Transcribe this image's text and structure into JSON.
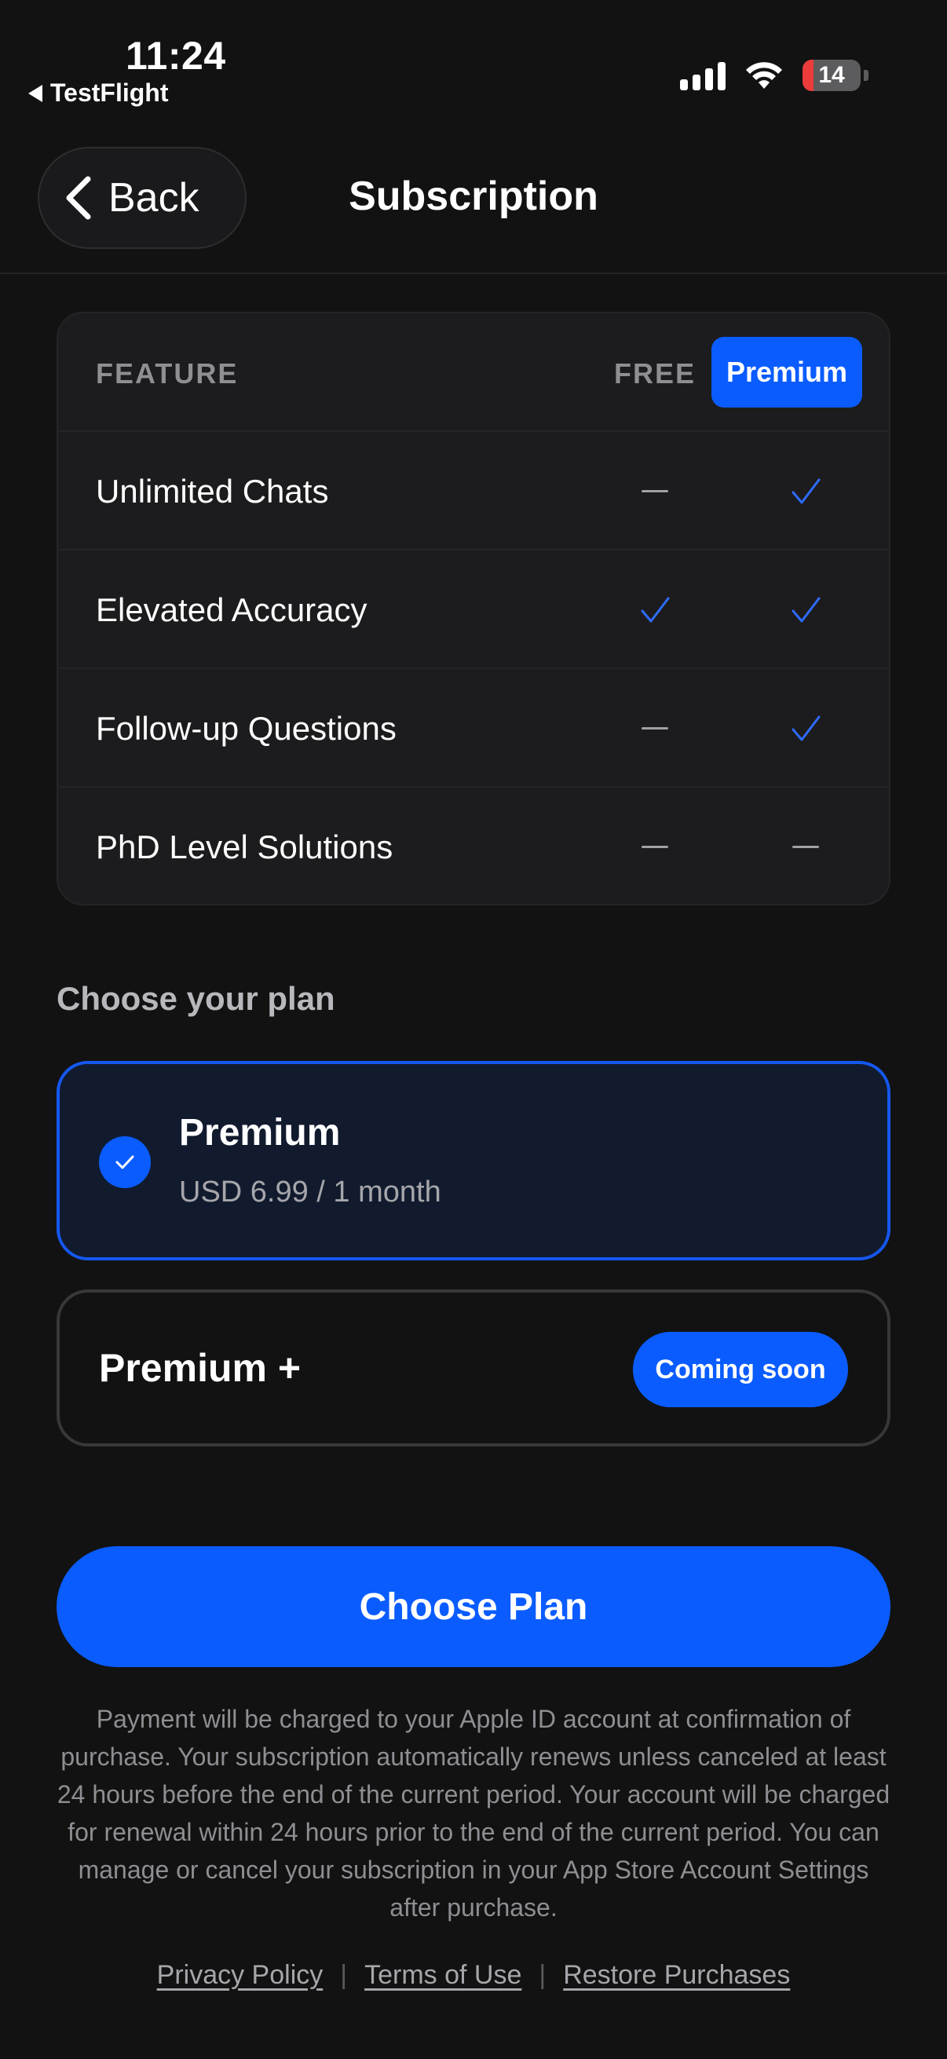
{
  "status_bar": {
    "time": "11:24",
    "back_app": "TestFlight",
    "battery": "14",
    "icons": [
      "signal-icon",
      "wifi-icon",
      "battery-icon"
    ]
  },
  "nav": {
    "back_label": "Back",
    "title": "Subscription"
  },
  "feature_table": {
    "headers": {
      "feature": "FEATURE",
      "free": "FREE",
      "premium": "Premium"
    },
    "rows": [
      {
        "name": "Unlimited Chats",
        "free": "dash",
        "premium": "check"
      },
      {
        "name": "Elevated Accuracy",
        "free": "check",
        "premium": "check"
      },
      {
        "name": "Follow-up Questions",
        "free": "dash",
        "premium": "check"
      },
      {
        "name": "PhD Level Solutions",
        "free": "dash",
        "premium": "dash"
      }
    ]
  },
  "plans": {
    "section_label": "Choose your plan",
    "selected": {
      "name": "Premium",
      "price": "USD 6.99 / 1 month"
    },
    "other": {
      "name": "Premium +",
      "badge": "Coming soon"
    }
  },
  "cta": {
    "label": "Choose Plan"
  },
  "legal_text": "Payment will be charged to your Apple ID account at confirmation of purchase. Your subscription automatically renews unless canceled at least 24 hours before the end of the current period. Your account will be charged for renewal within 24 hours prior to the end of the current period. You can manage or cancel your subscription in your App Store Account Settings after purchase.",
  "footer": {
    "privacy": "Privacy Policy",
    "terms": "Terms of Use",
    "restore": "Restore Purchases",
    "separator": "|"
  },
  "colors": {
    "accent": "#0a5cff",
    "background": "#121212",
    "card": "#1c1c1e",
    "muted_text": "#8e8e93"
  }
}
